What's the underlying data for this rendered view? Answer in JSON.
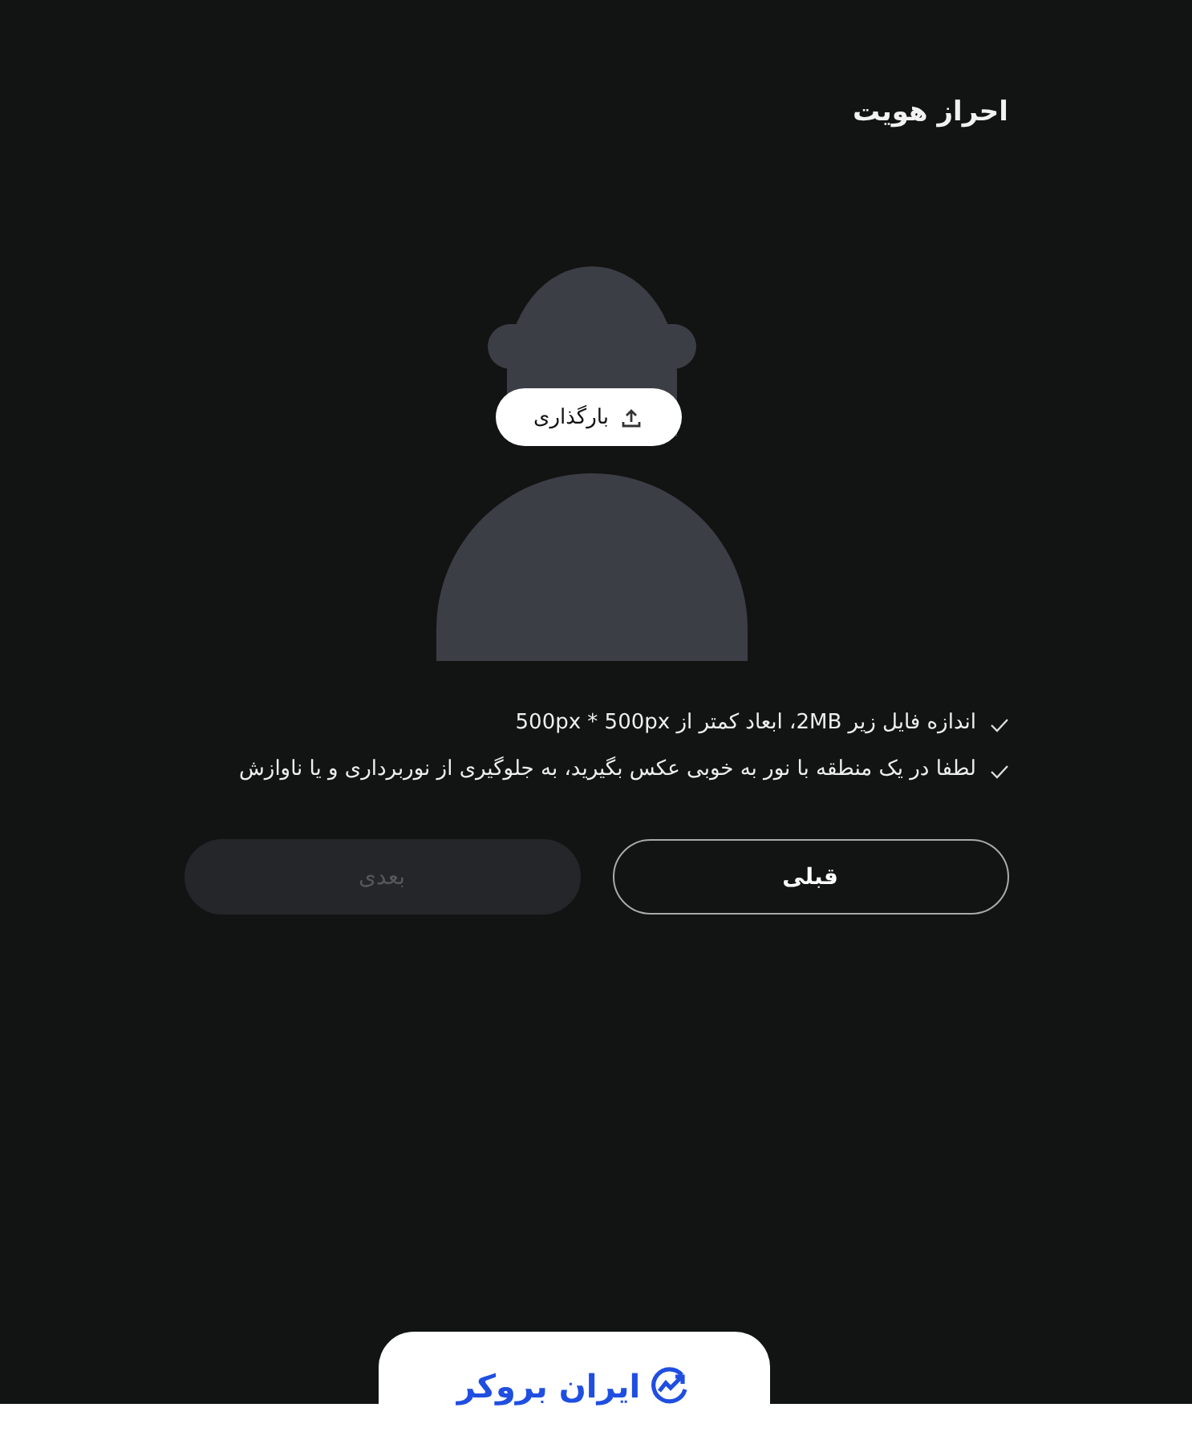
{
  "title": "احراز هویت",
  "photo": {
    "upload_button": "بارگذاری"
  },
  "requirements": [
    {
      "text": "اندازه فایل زیر 2MB، ابعاد کمتر از 500px * 500px"
    },
    {
      "text": "لطفا در یک منطقه با نور به خوبی عکس بگیرید، به جلوگیری از نوربرداری و یا ناوازش"
    }
  ],
  "buttons": [
    {
      "label": "قبلی",
      "disabled": false
    },
    {
      "label": "بعدی",
      "disabled": true
    }
  ],
  "footer": {
    "logo_text": "ایران بروکر"
  }
}
